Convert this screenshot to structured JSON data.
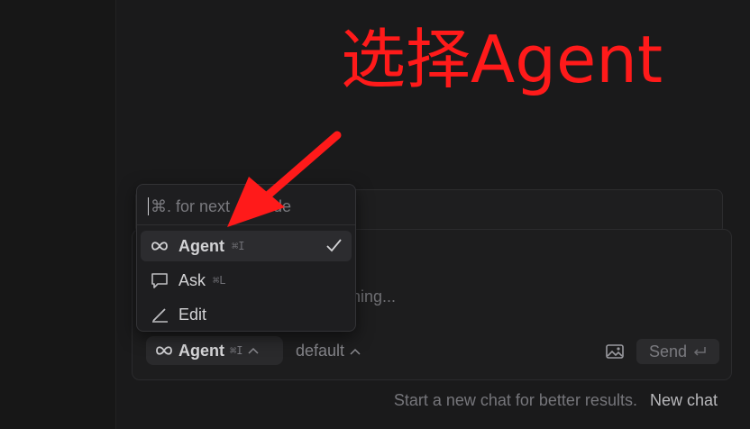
{
  "annotation": {
    "title": "选择Agent",
    "color": "#ff1a1a"
  },
  "composer": {
    "placeholder_visible": "ything...",
    "mode_chip": {
      "label": "Agent",
      "shortcut": "⌘I",
      "icon": "infinity-icon"
    },
    "model_select": {
      "label": "default",
      "icon": "chevron-up-icon"
    },
    "image_button_icon": "image-icon",
    "send": {
      "label": "Send",
      "icon": "enter-key-icon"
    }
  },
  "menu": {
    "search_visible_start": "⌘. for next",
    "search_visible_end": "ode",
    "items": [
      {
        "label": "Agent",
        "shortcut": "⌘I",
        "icon": "infinity-icon",
        "selected": true
      },
      {
        "label": "Ask",
        "shortcut": "⌘L",
        "icon": "chat-bubble-icon",
        "selected": false
      },
      {
        "label": "Edit",
        "shortcut": "",
        "icon": "pencil-icon",
        "selected": false
      }
    ]
  },
  "footer": {
    "hint": "Start a new chat for better results.",
    "new_chat_label": "New chat"
  },
  "colors": {
    "background": "#1a1a1b",
    "accent_red": "#ff1a1a"
  }
}
